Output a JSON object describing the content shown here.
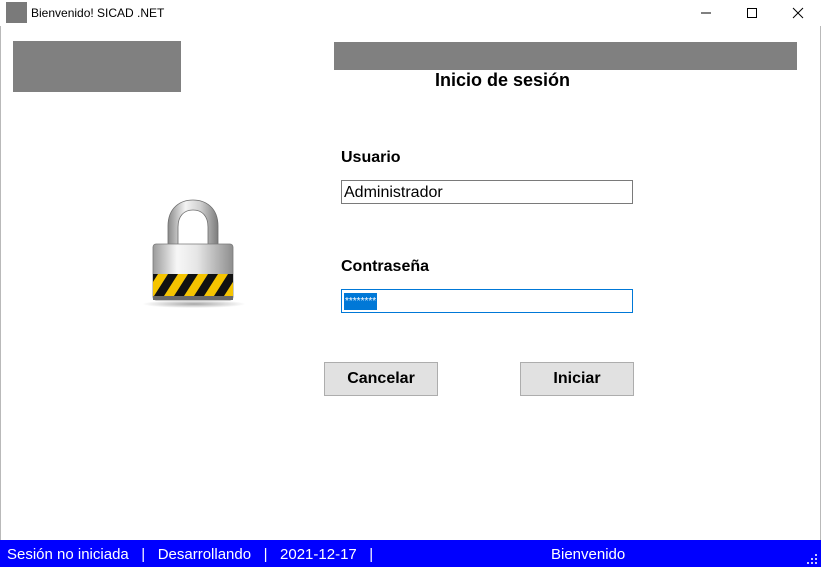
{
  "window": {
    "title": "Bienvenido! SICAD .NET",
    "icon": "app-icon",
    "controls": [
      "minimize-icon",
      "maximize-icon",
      "close-icon"
    ]
  },
  "login": {
    "title": "Inicio de sesión",
    "username_label": "Usuario",
    "username_value": "Administrador",
    "password_label": "Contraseña",
    "password_value": "********",
    "cancel_label": "Cancelar",
    "login_label": "Iniciar",
    "lock_icon": "padlock-icon"
  },
  "status": {
    "session": "Sesión no iniciada",
    "mode": "Desarrollando",
    "date": "2021-12-17",
    "separator": "|",
    "welcome": "Bienvenido"
  },
  "colors": {
    "statusbar": "#0000ff",
    "selection": "#0078d7",
    "placeholder_gray": "#808080",
    "button_bg": "#e1e1e1"
  }
}
